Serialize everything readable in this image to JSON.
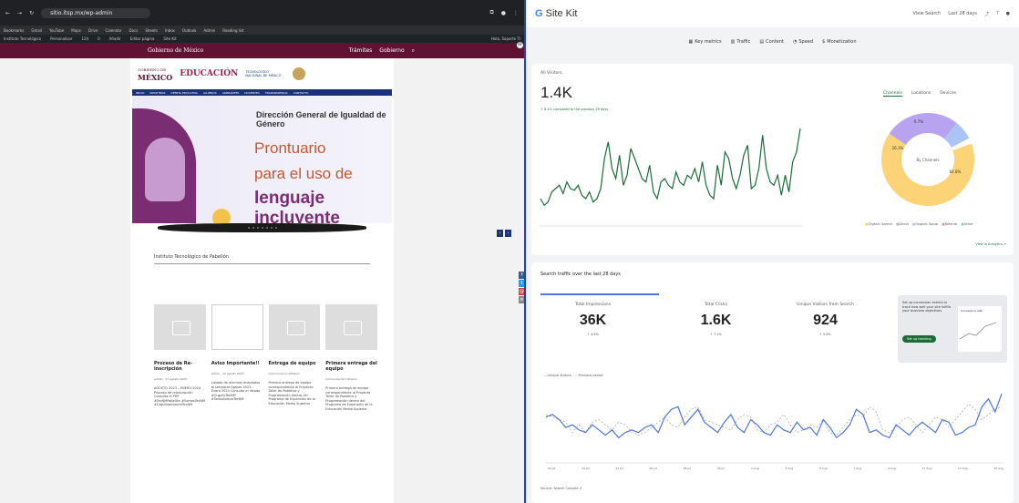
{
  "browser": {
    "url": "sitio.itsp.mx/wp-admin",
    "bookmarks": [
      "Bookmarks",
      "Gmail",
      "YouTube",
      "Maps",
      "Drive",
      "Calendar",
      "Docs",
      "Sheets",
      "Inbox",
      "Outlook",
      "Admin",
      "Reading list"
    ],
    "wp_bar": [
      "Instituto Tecnológico",
      "Personalizar",
      "124",
      "0",
      "Añadir",
      "Editar página",
      "Site Kit",
      "Hola, Soporte TI"
    ]
  },
  "gov_bar": {
    "logo": "Gobierno de México",
    "links": [
      "Trámites",
      "Gobierno"
    ]
  },
  "site": {
    "sep_logo_top": "GOBIERNO DE",
    "sep_logo_bottom": "MÉXICO",
    "sep_edu": "EDUCACIÓN",
    "tecnm": "TECNOLÓGICO NACIONAL DE MÉXICO",
    "nav": [
      "INICIO",
      "NOSOTROS",
      "OFERTA EDUCATIVA",
      "ALUMNOS",
      "ASPIRANTES",
      "DOCENTES",
      "TRANSPARENCIA",
      "CONTACTO"
    ],
    "hero_title": "Dirección General de Igualdad de Género",
    "hero_l1": "Prontuario",
    "hero_l2": "para el uso de",
    "hero_l3": "lenguaje incluyente",
    "institute": "Instituto Tecnológico de Pabellón",
    "cards": [
      {
        "title": "Proceso de Re-inscripción",
        "meta": "admin · 17 agosto 2023",
        "text": "AGOSTO 2023 – ENERO 2024 Proceso de reinscripción Consulta el PDF #TecNMPabellón #SomosTecNM #OrgullosamenteTecNM"
      },
      {
        "title": "Aviso Importante!!",
        "meta": "admin · 14 agosto 2023",
        "text": "Listado de alumnos aceptados al semestre Agosto 2023 – Enero 2024 Consulta el listado #OrgulloTecNM #TodosSomosTecNM"
      },
      {
        "title": "Entrega de equipo",
        "meta": "Comunicación Difusión",
        "text": "Primera entrega de equipo correspondiente al Proyecto Taller de Robótica y Programación dentro del Programa de Expansión de la Educación Media Superior"
      },
      {
        "title": "Primera entrega del equipo",
        "meta": "Comunicación Difusión",
        "text": "Primera entrega de equipo correspondiente al Proyecto Taller de Robótica y Programación dentro del Programa de Expansión de la Educación Media Superior"
      }
    ]
  },
  "sitekit": {
    "brand_g": "G",
    "brand": "Site Kit",
    "header_right": [
      "View Search",
      "Last 28 days"
    ],
    "nav": [
      "Key metrics",
      "Traffic",
      "Content",
      "Speed",
      "Monetization"
    ],
    "all_visitors_label": "All Visitors",
    "all_visitors": "1.4K",
    "change_note": "↑ 8.4% compared to the previous 28 days",
    "tabs": [
      "Channels",
      "Locations",
      "Devices"
    ],
    "donut_center": "By Channels",
    "donut_legend": [
      "Organic Search",
      "Direct",
      "Organic Social",
      "Referral",
      "Other"
    ],
    "donut_pcts": [
      "64.8%",
      "26.3%",
      "6.7%"
    ],
    "view_ga": "View in Analytics ↗",
    "search_title": "Search traffic over the last 28 days",
    "metrics": [
      {
        "label": "Total Impressions",
        "value": "36K",
        "change": "↑ 4.6%"
      },
      {
        "label": "Total Clicks",
        "value": "1.6K",
        "change": "↑ 7.1%"
      },
      {
        "label": "Unique Visitors from Search",
        "value": "924",
        "change": "↑ 5.8%"
      }
    ],
    "promo_text": "Set up conversion events to track how well your site fulfills your business objectives",
    "promo_button": "Set up tracking",
    "promo_card_title": "Conversion rate",
    "legend2": [
      "Unique Visitors",
      "Previous period"
    ],
    "source": "Source: Search Console ↗",
    "x_dates": [
      "20 Jul",
      "22 Jul",
      "24 Jul",
      "26 Jul",
      "28 Jul",
      "30 Jul",
      "1 Aug",
      "3 Aug",
      "5 Aug",
      "7 Aug",
      "9 Aug",
      "11 Aug",
      "13 Aug",
      "15 Aug"
    ],
    "visitors_series": [
      52,
      48,
      50,
      56,
      58,
      60,
      55,
      62,
      58,
      57,
      60,
      54,
      52,
      56,
      50,
      52,
      58,
      76,
      86,
      70,
      64,
      78,
      60,
      66,
      82,
      76,
      70,
      64,
      62,
      72,
      56,
      52,
      62,
      64,
      60,
      58,
      68,
      62,
      60,
      66,
      64,
      70,
      62,
      74,
      60,
      54,
      52,
      72,
      60,
      80,
      76,
      64,
      58,
      66,
      78,
      84,
      58,
      60,
      70,
      90,
      70,
      62,
      60,
      66,
      54,
      66,
      56,
      74,
      80,
      94
    ],
    "search_series": [
      72,
      74,
      70,
      64,
      66,
      62,
      60,
      66,
      62,
      58,
      62,
      56,
      60,
      62,
      60,
      64,
      66,
      60,
      72,
      78,
      80,
      66,
      72,
      78,
      68,
      64,
      60,
      68,
      74,
      64,
      60,
      70,
      66,
      60,
      58,
      66,
      62,
      60,
      68,
      62,
      64,
      58,
      70,
      64,
      56,
      60,
      66,
      78,
      74,
      60,
      62,
      58,
      56,
      66,
      62,
      58,
      64,
      68,
      64,
      60,
      70,
      68,
      58,
      60,
      64,
      66,
      80,
      86,
      76,
      90
    ],
    "prev_series": [
      74,
      72,
      70,
      68,
      60,
      66,
      60,
      68,
      70,
      66,
      62,
      68,
      66,
      60,
      58,
      60,
      64,
      68,
      72,
      66,
      64,
      72,
      78,
      80,
      70,
      68,
      66,
      64,
      62,
      70,
      74,
      72,
      62,
      60,
      66,
      68,
      74,
      66,
      60,
      62,
      66,
      64,
      70,
      60,
      58,
      64,
      70,
      74,
      72,
      80,
      76,
      62,
      60,
      64,
      70,
      72,
      66,
      60,
      66,
      72,
      70,
      64,
      70,
      76,
      82,
      78,
      70,
      74,
      78,
      80
    ],
    "colors": {
      "green": "#1e6b3a",
      "blue": "#4f76d9",
      "donut_a": "#fcd477",
      "donut_b": "#b8a3f0",
      "donut_c": "#a9c4f5"
    }
  }
}
